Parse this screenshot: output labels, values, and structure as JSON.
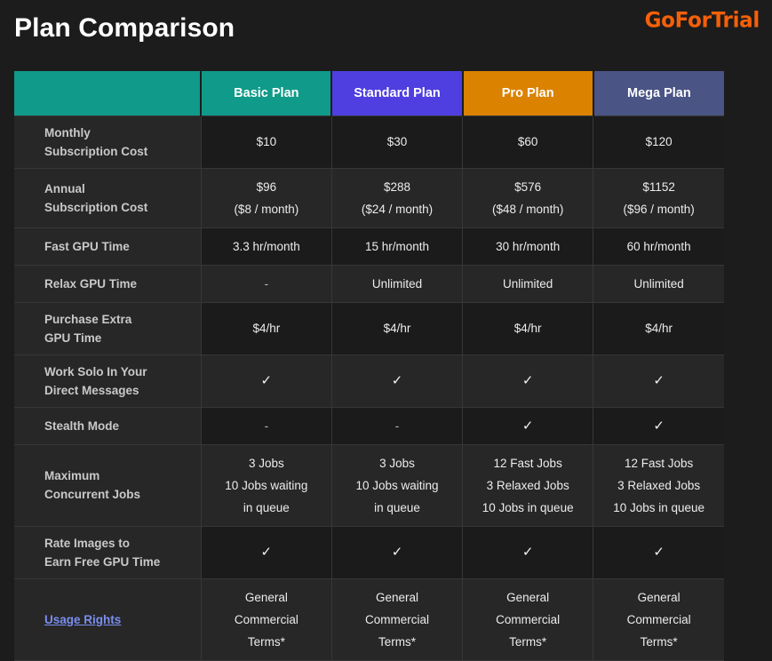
{
  "header": {
    "title": "Plan Comparison",
    "brand": "GoForTrial"
  },
  "colors": {
    "page_background": "#1c1c1c",
    "basic_header": "#109a89",
    "standard_header": "#4f3fe0",
    "pro_header": "#db8200",
    "mega_header": "#4a5485",
    "brand_orange": "#f5600a",
    "link_blue": "#7b8ef0",
    "row_dark": "#1b1b1b",
    "row_light": "#272727",
    "label_background": "#272727",
    "cell_border": "#373737"
  },
  "table": {
    "columns": [
      {
        "key": "feature",
        "label": ""
      },
      {
        "key": "basic",
        "label": "Basic Plan"
      },
      {
        "key": "standard",
        "label": "Standard Plan"
      },
      {
        "key": "pro",
        "label": "Pro Plan"
      },
      {
        "key": "mega",
        "label": "Mega Plan"
      }
    ],
    "rows": [
      {
        "label_line1": "Monthly",
        "label_line2": "Subscription Cost",
        "basic_line1": "$10",
        "basic_line2": "",
        "basic_line3": "",
        "standard_line1": "$30",
        "standard_line2": "",
        "standard_line3": "",
        "pro_line1": "$60",
        "pro_line2": "",
        "pro_line3": "",
        "mega_line1": "$120",
        "mega_line2": "",
        "mega_line3": ""
      },
      {
        "label_line1": "Annual",
        "label_line2": "Subscription Cost",
        "basic_line1": "$96",
        "basic_line2": "($8 / month)",
        "basic_line3": "",
        "standard_line1": "$288",
        "standard_line2": "($24 / month)",
        "standard_line3": "",
        "pro_line1": "$576",
        "pro_line2": "($48 / month)",
        "pro_line3": "",
        "mega_line1": "$1152",
        "mega_line2": "($96 / month)",
        "mega_line3": ""
      },
      {
        "label_line1": "Fast GPU Time",
        "label_line2": "",
        "basic_line1": "3.3 hr/month",
        "basic_line2": "",
        "basic_line3": "",
        "standard_line1": "15 hr/month",
        "standard_line2": "",
        "standard_line3": "",
        "pro_line1": "30 hr/month",
        "pro_line2": "",
        "pro_line3": "",
        "mega_line1": "60 hr/month",
        "mega_line2": "",
        "mega_line3": ""
      },
      {
        "label_line1": "Relax GPU Time",
        "label_line2": "",
        "basic_line1": "-",
        "basic_line2": "",
        "basic_line3": "",
        "standard_line1": "Unlimited",
        "standard_line2": "",
        "standard_line3": "",
        "pro_line1": "Unlimited",
        "pro_line2": "",
        "pro_line3": "",
        "mega_line1": "Unlimited",
        "mega_line2": "",
        "mega_line3": ""
      },
      {
        "label_line1": "Purchase Extra",
        "label_line2": "GPU Time",
        "basic_line1": "$4/hr",
        "basic_line2": "",
        "basic_line3": "",
        "standard_line1": "$4/hr",
        "standard_line2": "",
        "standard_line3": "",
        "pro_line1": "$4/hr",
        "pro_line2": "",
        "pro_line3": "",
        "mega_line1": "$4/hr",
        "mega_line2": "",
        "mega_line3": ""
      },
      {
        "label_line1": "Work Solo In Your",
        "label_line2": "Direct Messages",
        "basic_line1": "✓",
        "basic_line2": "",
        "basic_line3": "",
        "standard_line1": "✓",
        "standard_line2": "",
        "standard_line3": "",
        "pro_line1": "✓",
        "pro_line2": "",
        "pro_line3": "",
        "mega_line1": "✓",
        "mega_line2": "",
        "mega_line3": ""
      },
      {
        "label_line1": "Stealth Mode",
        "label_line2": "",
        "basic_line1": "-",
        "basic_line2": "",
        "basic_line3": "",
        "standard_line1": "-",
        "standard_line2": "",
        "standard_line3": "",
        "pro_line1": "✓",
        "pro_line2": "",
        "pro_line3": "",
        "mega_line1": "✓",
        "mega_line2": "",
        "mega_line3": ""
      },
      {
        "label_line1": "Maximum",
        "label_line2": "Concurrent Jobs",
        "basic_line1": "3 Jobs",
        "basic_line2": "10 Jobs waiting",
        "basic_line3": "in queue",
        "standard_line1": "3 Jobs",
        "standard_line2": "10 Jobs waiting",
        "standard_line3": "in queue",
        "pro_line1": "12 Fast Jobs",
        "pro_line2": "3 Relaxed Jobs",
        "pro_line3": "10 Jobs in queue",
        "mega_line1": "12 Fast Jobs",
        "mega_line2": "3 Relaxed Jobs",
        "mega_line3": "10 Jobs in queue"
      },
      {
        "label_line1": "Rate Images to",
        "label_line2": "Earn Free GPU Time",
        "basic_line1": "✓",
        "basic_line2": "",
        "basic_line3": "",
        "standard_line1": "✓",
        "standard_line2": "",
        "standard_line3": "",
        "pro_line1": "✓",
        "pro_line2": "",
        "pro_line3": "",
        "mega_line1": "✓",
        "mega_line2": "",
        "mega_line3": ""
      },
      {
        "label_line1": "Usage Rights",
        "label_line2": "",
        "basic_line1": "General",
        "basic_line2": "Commercial",
        "basic_line3": "Terms*",
        "standard_line1": "General",
        "standard_line2": "Commercial",
        "standard_line3": "Terms*",
        "pro_line1": "General",
        "pro_line2": "Commercial",
        "pro_line3": "Terms*",
        "mega_line1": "General",
        "mega_line2": "Commercial",
        "mega_line3": "Terms*"
      }
    ]
  }
}
